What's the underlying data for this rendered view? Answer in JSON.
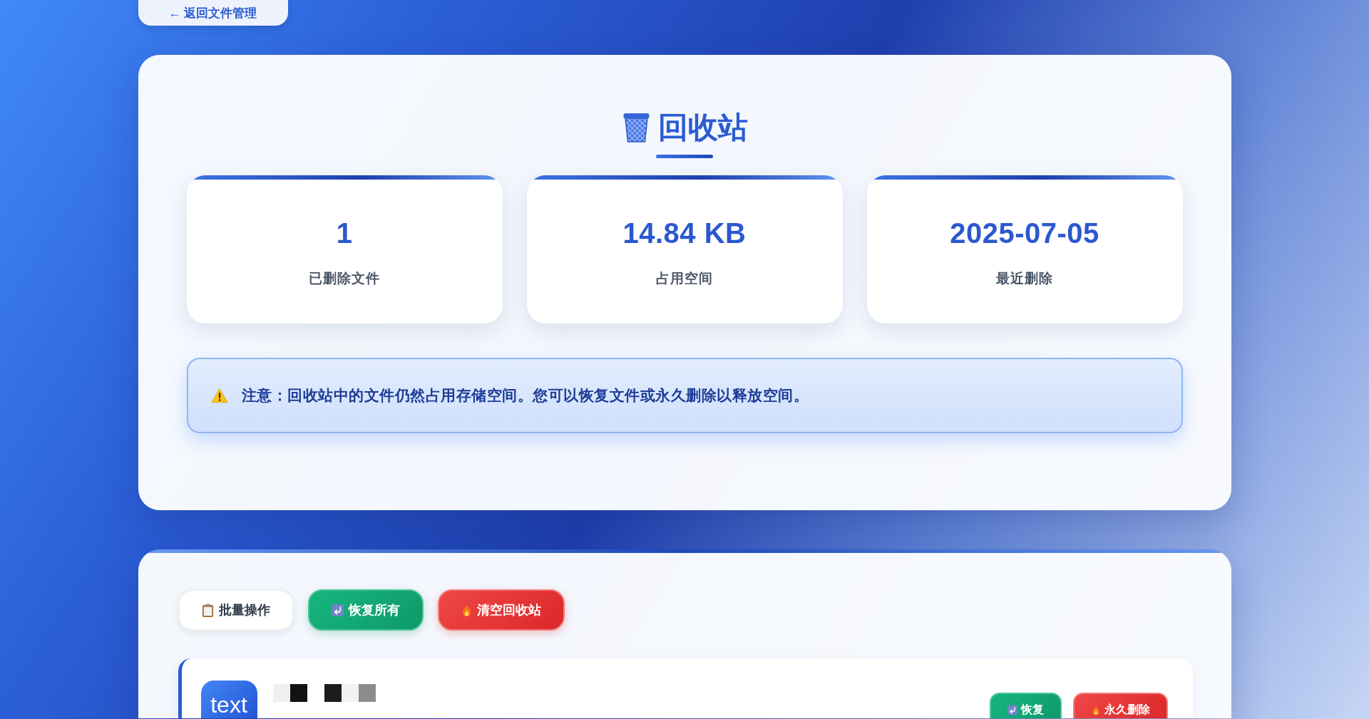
{
  "back_link": {
    "label": "← 返回文件管理"
  },
  "header": {
    "title": "回收站"
  },
  "stats": [
    {
      "value": "1",
      "label": "已删除文件"
    },
    {
      "value": "14.84 KB",
      "label": "占用空间"
    },
    {
      "value": "2025-07-05",
      "label": "最近删除"
    }
  ],
  "notice": {
    "text": "注意：回收站中的文件仍然占用存储空间。您可以恢复文件或永久删除以释放空间。"
  },
  "toolbar": {
    "buttons": [
      {
        "label": "批量操作",
        "kind": "neutral"
      },
      {
        "label": "恢复所有",
        "kind": "restore"
      },
      {
        "label": "清空回收站",
        "kind": "danger"
      }
    ]
  },
  "files": [
    {
      "type_badge": "text",
      "actions": [
        {
          "label": "恢复",
          "kind": "restore"
        },
        {
          "label": "永久删除",
          "kind": "danger"
        }
      ]
    }
  ]
}
